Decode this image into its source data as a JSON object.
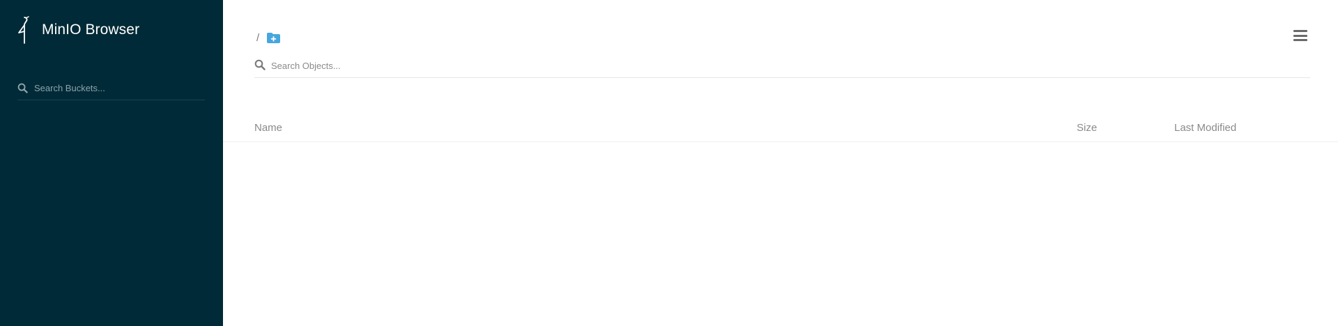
{
  "app": {
    "title": "MinIO Browser"
  },
  "sidebar": {
    "search": {
      "placeholder": "Search Buckets..."
    }
  },
  "breadcrumb": {
    "separator": "/"
  },
  "objects": {
    "search": {
      "placeholder": "Search Objects..."
    }
  },
  "table": {
    "columns": [
      "Name",
      "Size",
      "Last Modified"
    ],
    "rows": []
  },
  "icons": {
    "logo": "minio-bird-icon",
    "bucket_search": "search-icon",
    "object_search": "search-icon",
    "create_folder": "folder-plus-icon",
    "menu": "hamburger-menu-icon"
  },
  "colors": {
    "sidebar_bg": "#002a37",
    "accent": "#46a6e0",
    "header_text": "#8a8a8a"
  }
}
